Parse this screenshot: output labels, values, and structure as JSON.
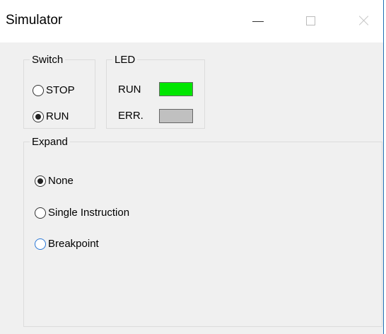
{
  "window": {
    "title": "Simulator",
    "controls": [
      "minimize-icon",
      "maximize-icon",
      "close-icon"
    ]
  },
  "switch_group": {
    "legend": "Switch",
    "options": [
      {
        "label": "STOP",
        "selected": false
      },
      {
        "label": "RUN",
        "selected": true
      }
    ]
  },
  "led_group": {
    "legend": "LED",
    "items": [
      {
        "label": "RUN",
        "color": "#00e600"
      },
      {
        "label": "ERR.",
        "color": "#c0c0c0"
      }
    ]
  },
  "expand_group": {
    "legend": "Expand",
    "options": [
      {
        "label": "None",
        "selected": true
      },
      {
        "label": "Single Instruction",
        "selected": false
      },
      {
        "label": "Breakpoint",
        "selected": false
      }
    ]
  },
  "colors": {
    "window_bg": "#f0f0f0",
    "titlebar_bg": "#ffffff",
    "led_run": "#00e600",
    "led_err": "#c0c0c0",
    "focus_accent": "#2a77d6"
  }
}
